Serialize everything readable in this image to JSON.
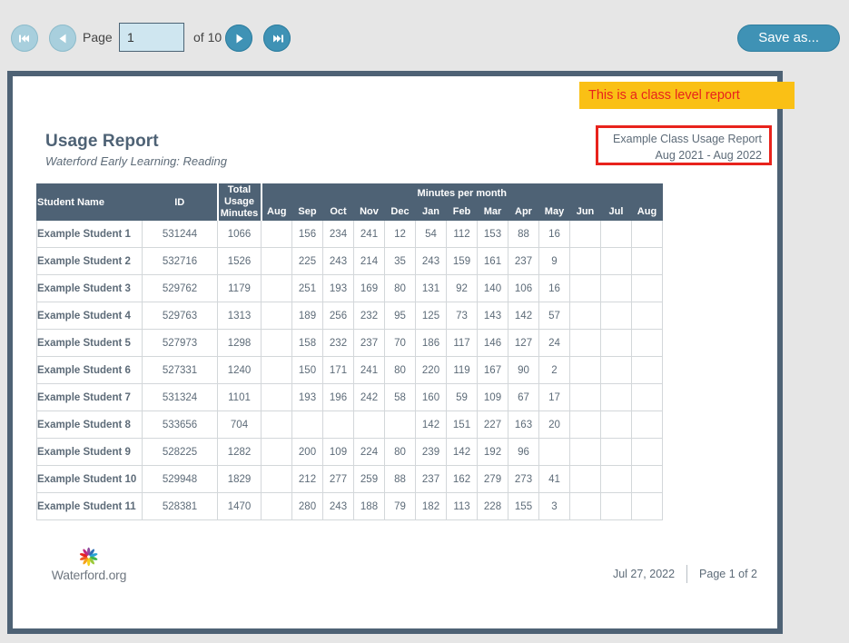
{
  "toolbar": {
    "first_icon": "skip-to-first-icon",
    "prev_icon": "previous-page-icon",
    "page_label": "Page",
    "page_value": "1",
    "page_placeholder": "",
    "of_label": "of 10",
    "next_icon": "next-page-icon",
    "last_icon": "skip-to-last-icon",
    "save_as_label": "Save as...",
    "accent_color": "#3f92b5",
    "disabled_color": "#a8cfdd",
    "input_bg": "#cfe6f0"
  },
  "callout": {
    "text": "This is a class level report",
    "background": "#fac015",
    "text_color": "#e8231c"
  },
  "report": {
    "title": "Usage Report",
    "subtitle": "Waterford Early Learning: Reading",
    "meta_line1": "Example Class Usage Report",
    "meta_line2": "Aug 2021 - Aug 2022",
    "meta_border_color": "#e8231c",
    "header_color": "#4e6275"
  },
  "table": {
    "col_student": "Student Name",
    "col_id": "ID",
    "col_total_l1": "Total",
    "col_total_l2": "Usage",
    "col_total_l3": "Minutes",
    "group_header": "Minutes per month",
    "months": [
      "Aug",
      "Sep",
      "Oct",
      "Nov",
      "Dec",
      "Jan",
      "Feb",
      "Mar",
      "Apr",
      "May",
      "Jun",
      "Jul",
      "Aug"
    ],
    "rows": [
      {
        "name": "Example Student 1",
        "id": "531244",
        "total": "1066",
        "months": [
          "",
          "156",
          "234",
          "241",
          "12",
          "54",
          "112",
          "153",
          "88",
          "16",
          "",
          "",
          ""
        ]
      },
      {
        "name": "Example Student 2",
        "id": "532716",
        "total": "1526",
        "months": [
          "",
          "225",
          "243",
          "214",
          "35",
          "243",
          "159",
          "161",
          "237",
          "9",
          "",
          "",
          ""
        ]
      },
      {
        "name": "Example Student 3",
        "id": "529762",
        "total": "1179",
        "months": [
          "",
          "251",
          "193",
          "169",
          "80",
          "131",
          "92",
          "140",
          "106",
          "16",
          "",
          "",
          ""
        ]
      },
      {
        "name": "Example Student 4",
        "id": "529763",
        "total": "1313",
        "months": [
          "",
          "189",
          "256",
          "232",
          "95",
          "125",
          "73",
          "143",
          "142",
          "57",
          "",
          "",
          ""
        ]
      },
      {
        "name": "Example Student 5",
        "id": "527973",
        "total": "1298",
        "months": [
          "",
          "158",
          "232",
          "237",
          "70",
          "186",
          "117",
          "146",
          "127",
          "24",
          "",
          "",
          ""
        ]
      },
      {
        "name": "Example Student 6",
        "id": "527331",
        "total": "1240",
        "months": [
          "",
          "150",
          "171",
          "241",
          "80",
          "220",
          "119",
          "167",
          "90",
          "2",
          "",
          "",
          ""
        ]
      },
      {
        "name": "Example Student 7",
        "id": "531324",
        "total": "1101",
        "months": [
          "",
          "193",
          "196",
          "242",
          "58",
          "160",
          "59",
          "109",
          "67",
          "17",
          "",
          "",
          ""
        ]
      },
      {
        "name": "Example Student 8",
        "id": "533656",
        "total": "704",
        "months": [
          "",
          "",
          "",
          "",
          "",
          "142",
          "151",
          "227",
          "163",
          "20",
          "",
          "",
          ""
        ]
      },
      {
        "name": "Example Student 9",
        "id": "528225",
        "total": "1282",
        "months": [
          "",
          "200",
          "109",
          "224",
          "80",
          "239",
          "142",
          "192",
          "96",
          "",
          "",
          "",
          ""
        ]
      },
      {
        "name": "Example Student 10",
        "id": "529948",
        "total": "1829",
        "months": [
          "",
          "212",
          "277",
          "259",
          "88",
          "237",
          "162",
          "279",
          "273",
          "41",
          "",
          "",
          ""
        ]
      },
      {
        "name": "Example Student 11",
        "id": "528381",
        "total": "1470",
        "months": [
          "",
          "280",
          "243",
          "188",
          "79",
          "182",
          "113",
          "228",
          "155",
          "3",
          "",
          "",
          ""
        ]
      }
    ]
  },
  "footer": {
    "logo_mark": "waterford-starburst-logo-icon",
    "logo_text": "Waterford.org",
    "date": "Jul 27, 2022",
    "page_of": "Page 1 of 2"
  }
}
